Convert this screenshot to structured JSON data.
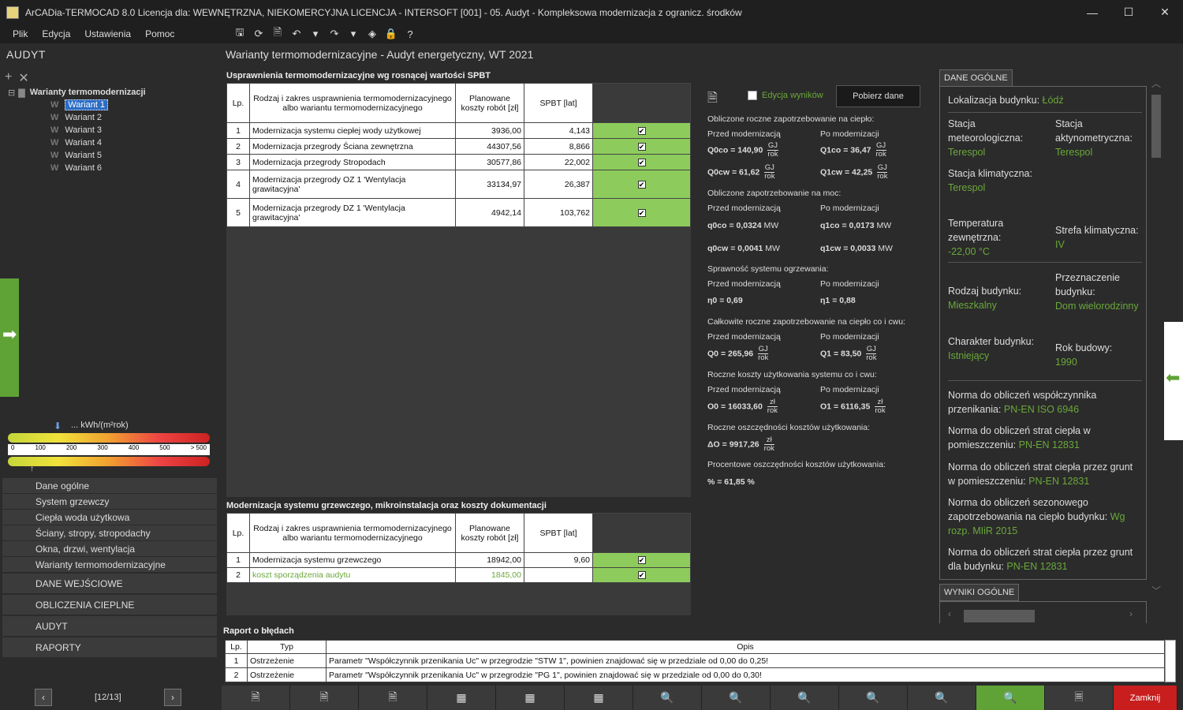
{
  "window": {
    "title": "ArCADia-TERMOCAD 8.0 Licencja dla: WEWNĘTRZNA, NIEKOMERCYJNA LICENCJA - INTERSOFT [001] - 05. Audyt - Kompleksowa modernizacja z ogranicz. środków",
    "minimize": "—",
    "maximize": "☐",
    "close": "✕"
  },
  "menu": [
    "Plik",
    "Edycja",
    "Ustawienia",
    "Pomoc"
  ],
  "toolbar": [
    "save-icon",
    "refresh-icon",
    "preview-icon",
    "undo-icon",
    "undo-dropdown-icon",
    "redo-icon",
    "redo-dropdown-icon",
    "layers-icon",
    "lock-icon",
    "help-icon"
  ],
  "toolbar_glyphs": [
    "🖫",
    "⟳",
    "🗎",
    "↶",
    "▾",
    "↷",
    "▾",
    "◈",
    "🔒",
    "?"
  ],
  "left": {
    "title": "AUDYT",
    "tree_root": "Warianty termomodernizacji",
    "tree_items": [
      "Wariant 1",
      "Wariant 2",
      "Wariant 3",
      "Wariant 4",
      "Wariant 5",
      "Wariant 6"
    ],
    "scale_label": "... kWh/(m²rok)",
    "scale_ticks": [
      "0",
      "100",
      "200",
      "300",
      "400",
      "500",
      "> 500"
    ],
    "nav_sub": [
      "Dane ogólne",
      "System grzewczy",
      "Ciepła woda użytkowa",
      "Ściany, stropy, stropodachy",
      "Okna, drzwi, wentylacja",
      "Warianty termomodernizacyjne"
    ],
    "nav_main": [
      "DANE WEJŚCIOWE",
      "OBLICZENIA CIEPLNE",
      "AUDYT",
      "RAPORTY"
    ],
    "pager": "[12/13]"
  },
  "main": {
    "title": "Warianty termomodernizacyjne - Audyt energetyczny, WT 2021",
    "sec1_title": "Usprawnienia termomodernizacyjne wg rosnącej wartości SPBT",
    "headers": [
      "Lp.",
      "Rodzaj i zakres usprawnienia termomodernizacyjnego albo wariantu termomodernizacyjnego",
      "Planowane koszty robót [zł]",
      "SPBT [lat]"
    ],
    "rows1": [
      {
        "lp": "1",
        "name": "Modernizacja systemu ciepłej wody użytkowej",
        "cost": "3936,00",
        "spbt": "4,143"
      },
      {
        "lp": "2",
        "name": "Modernizacja przegrody Ściana zewnętrzna",
        "cost": "44307,56",
        "spbt": "8,866"
      },
      {
        "lp": "3",
        "name": "Modernizacja przegrody Stropodach",
        "cost": "30577,86",
        "spbt": "22,002"
      },
      {
        "lp": "4",
        "name": "Modernizacja przegrody OZ 1 'Wentylacja grawitacyjna'",
        "cost": "33134,97",
        "spbt": "26,387"
      },
      {
        "lp": "5",
        "name": "Modernizacja przegrody DZ 1 'Wentylacja grawitacyjna'",
        "cost": "4942,14",
        "spbt": "103,762"
      }
    ],
    "sec2_title": "Modernizacja systemu grzewczego, mikroinstalacja oraz koszty dokumentacji",
    "rows2": [
      {
        "lp": "1",
        "name": "Modernizacja systemu grzewczego",
        "cost": "18942,00",
        "spbt": "9,60"
      },
      {
        "lp": "2",
        "name": "koszt sporządzenia audytu",
        "cost": "1845,00",
        "spbt": ""
      }
    ]
  },
  "results": {
    "edit_label": "Edycja wyników",
    "fetch_button": "Pobierz dane",
    "before": "Przed modernizacją",
    "after": "Po modernizacji",
    "heat_title": "Obliczone roczne zapotrzebowanie na ciepło:",
    "q0co": "Q0co",
    "q0co_val": "= 140,90",
    "q1co": "Q1co",
    "q1co_val": "= 36,47",
    "q0cw": "Q0cw",
    "q0cw_val": "= 61,62",
    "q1cw": "Q1cw",
    "q1cw_val": "= 42,25",
    "unit_gj": "GJ",
    "unit_rok": "rok",
    "power_title": "Obliczone zapotrzebowanie na moc:",
    "p0co": "q0co",
    "p0co_val": "= 0,0324",
    "p1co": "q1co",
    "p1co_val": "= 0,0173",
    "p0cw": "q0cw",
    "p0cw_val": "= 0,0041",
    "p1cw": "q1cw",
    "p1cw_val": "= 0,0033",
    "unit_mw": "MW",
    "eff_title": "Sprawność systemu ogrzewania:",
    "eta0": "η0",
    "eta0_val": "= 0,69",
    "eta1": "η1",
    "eta1_val": "= 0,88",
    "total_title": "Całkowite roczne zapotrzebowanie na ciepło co i cwu:",
    "qt0": "Q0",
    "qt0_val": "= 265,96",
    "qt1": "Q1",
    "qt1_val": "= 83,50",
    "cost_title": "Roczne koszty użytkowania systemu co i cwu:",
    "o0": "O0",
    "o0_val": "= 16033,60",
    "o1": "O1",
    "o1_val": "= 6116,35",
    "unit_zl": "zł",
    "save_title": "Roczne oszczędności kosztów użytkowania:",
    "dO": "ΔO",
    "dO_val": "= 9917,26",
    "pct_title": "Procentowe oszczędności kosztów użytkowania:",
    "pct_val": "% = 61,85  %"
  },
  "general": {
    "tab1": "DANE OGÓLNE",
    "tab2": "WYNIKI OGÓLNE",
    "loc_label": "Lokalizacja budynku:",
    "loc_val": "Łódź",
    "met_label": "Stacja meteorologiczna:",
    "met_val": "Terespol",
    "act_label": "Stacja aktynometryczna:",
    "act_val": "Terespol",
    "clim_label": "Stacja klimatyczna:",
    "clim_val": "Terespol",
    "temp_label": "Temperatura zewnętrzna:",
    "temp_val": "-22,00 °C",
    "zone_label": "Strefa klimatyczna:",
    "zone_val": "IV",
    "type_label": "Rodzaj budynku:",
    "type_val": "Mieszkalny",
    "purpose_label": "Przeznaczenie budynku:",
    "purpose_val": "Dom wielorodzinny",
    "char_label": "Charakter budynku:",
    "char_val": "Istniejący",
    "year_label": "Rok budowy:",
    "year_val": "1990",
    "norm1_label": "Norma do obliczeń współczynnika przenikania:",
    "norm1_val": "PN-EN ISO 6946",
    "norm2_label": "Norma do obliczeń strat ciepła w pomieszczeniu:",
    "norm2_val": "PN-EN 12831",
    "norm3_label": "Norma do obliczeń strat ciepła przez grunt w pomieszczeniu:",
    "norm3_val": "PN-EN 12831",
    "norm4_label": "Norma do obliczeń sezonowego zapotrzebowania na ciepło budynku:",
    "norm4_val": "Wg rozp. MIiR 2015",
    "norm5_label": "Norma do obliczeń strat ciepła przez grunt dla budynku:",
    "norm5_val": "PN-EN 12831"
  },
  "errors": {
    "title": "Raport o błędach",
    "headers": [
      "Lp.",
      "Typ",
      "Opis"
    ],
    "rows": [
      {
        "lp": "1",
        "typ": "Ostrzeżenie",
        "opis": "Parametr \"Współczynnik przenikania Uc\" w przegrodzie \"STW 1\", powinien znajdować się w przedziale od 0,00 do 0,25!"
      },
      {
        "lp": "2",
        "typ": "Ostrzeżenie",
        "opis": "Parametr \"Współczynnik przenikania Uc\" w przegrodzie \"PG 1\", powinien znajdować się w przedziale od 0,00 do 0,30!"
      }
    ]
  },
  "bottom": {
    "close": "Zamknij",
    "icons": [
      "export-doc-icon",
      "export-doc-icon",
      "export-doc-icon",
      "table-icon",
      "table-icon",
      "table-icon",
      "search-doc-icon",
      "search-doc-icon",
      "search-doc-icon",
      "search-doc-icon",
      "search-doc-icon",
      "search-doc-icon",
      "report-icon"
    ],
    "glyphs": [
      "🗎",
      "🗎",
      "🗎",
      "▦",
      "▦",
      "▦",
      "🔍",
      "🔍",
      "🔍",
      "🔍",
      "🔍",
      "🔍",
      "🗏"
    ]
  },
  "colors": {
    "accent_green": "#5fa336",
    "value_green": "#6aa83a",
    "close_red": "#c81e1e",
    "selection_blue": "#2b6cc4"
  }
}
